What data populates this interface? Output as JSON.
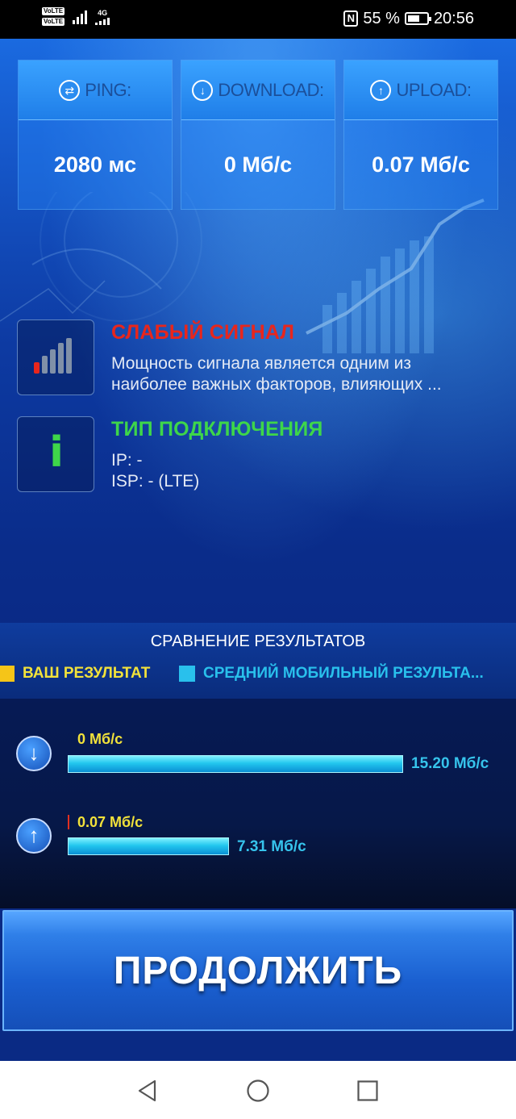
{
  "status_bar": {
    "sim1": "VoLTE",
    "sim2": "VoLTE",
    "network": "4G",
    "battery": "55 %",
    "time": "20:56"
  },
  "metrics": [
    {
      "label": "PING:",
      "value": "2080 мс",
      "icon": "ping-icon"
    },
    {
      "label": "DOWNLOAD:",
      "value": "0 Мб/с",
      "icon": "download-icon"
    },
    {
      "label": "UPLOAD:",
      "value": "0.07 Мб/с",
      "icon": "upload-icon"
    }
  ],
  "signal": {
    "title": "СЛАБЫЙ СИГНАЛ",
    "line1": "Мощность сигнала является одним из",
    "line2": "наиболее важных факторов, влияющих ...",
    "title_color": "#e8261c"
  },
  "connection": {
    "title": "ТИП ПОДКЛЮЧЕНИЯ",
    "ip": "IP: -",
    "isp": "ISP: - (LTE)",
    "title_color": "#3ed64a"
  },
  "comparison": {
    "title": "СРАВНЕНИЕ РЕЗУЛЬТАТОВ",
    "legend_yours": "ВАШ РЕЗУЛЬТАТ",
    "legend_avg": "СРЕДНИЙ МОБИЛЬНЫЙ РЕЗУЛЬТА...",
    "yours_color": "#f5c518",
    "avg_color": "#29c0ec",
    "download": {
      "yours": "0 Мб/с",
      "avg": "15.20 Мб/с",
      "yours_value": 0,
      "avg_value": 15.2
    },
    "upload": {
      "yours": "0.07 Мб/с",
      "avg": "7.31 Мб/с",
      "yours_value": 0.07,
      "avg_value": 7.31
    }
  },
  "continue_label": "ПРОДОЛЖИТЬ",
  "nav": {
    "back": "back-icon",
    "home": "home-icon",
    "recents": "recents-icon"
  }
}
